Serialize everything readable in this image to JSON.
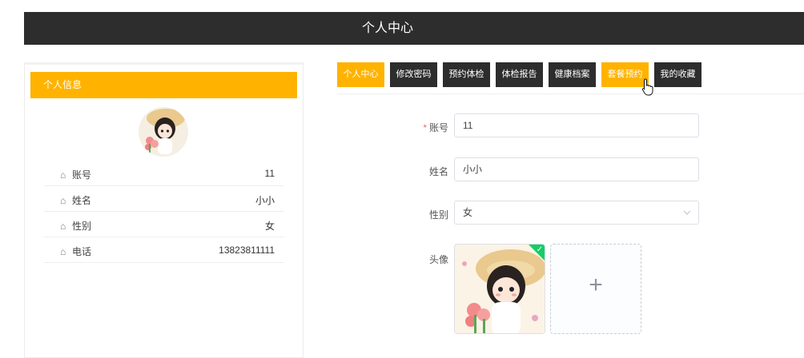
{
  "header": {
    "title": "个人中心"
  },
  "left_panel": {
    "title": "个人信息",
    "rows": [
      {
        "label": "账号",
        "value": "11"
      },
      {
        "label": "姓名",
        "value": "小小"
      },
      {
        "label": "性别",
        "value": "女"
      },
      {
        "label": "电话",
        "value": "13823811111"
      }
    ]
  },
  "tabs": [
    {
      "label": "个人中心",
      "active": true
    },
    {
      "label": "修改密码",
      "active": false
    },
    {
      "label": "预约体检",
      "active": false
    },
    {
      "label": "体检报告",
      "active": false
    },
    {
      "label": "健康档案",
      "active": false
    },
    {
      "label": "套餐预约",
      "active": true
    },
    {
      "label": "我的收藏",
      "active": false
    }
  ],
  "form": {
    "account": {
      "label": "账号",
      "required_mark": "*",
      "value": "11"
    },
    "name": {
      "label": "姓名",
      "value": "小小"
    },
    "gender": {
      "label": "性别",
      "value": "女"
    },
    "avatar": {
      "label": "头像",
      "add_symbol": "+"
    }
  },
  "colors": {
    "accent": "#ffb300",
    "dark": "#2d2d2d",
    "success": "#13ce66"
  },
  "icons": {
    "row_icon": "home-icon",
    "select_icon": "chevron-down-icon",
    "upload_icon": "plus-icon",
    "status_icon": "check-icon"
  }
}
